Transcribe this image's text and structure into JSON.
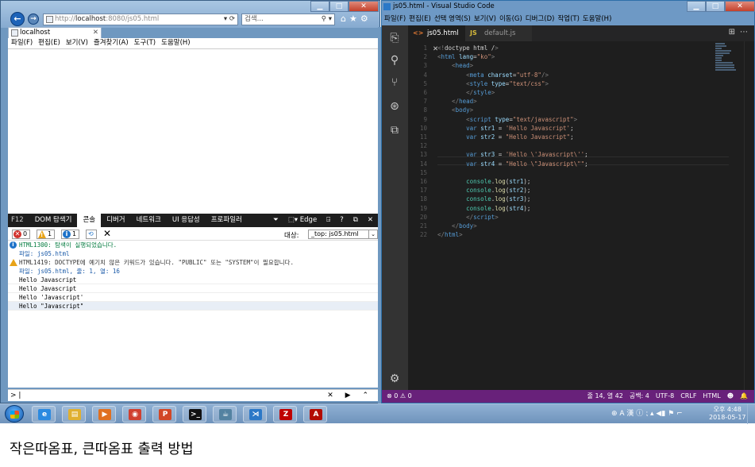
{
  "ie": {
    "address": {
      "prefix": "http://",
      "host": "localhost",
      "rest": ":8080/js05.html",
      "extra": "▾ ⟳"
    },
    "search_placeholder": "검색...",
    "tab_title": "localhost",
    "menu": [
      "파일(F)",
      "편집(E)",
      "보기(V)",
      "즐겨찾기(A)",
      "도구(T)",
      "도움말(H)"
    ],
    "devtools": {
      "f12_label": "F12",
      "tabs": [
        "DOM 탐색기",
        "콘솔",
        "디버거",
        "네트워크",
        "UI 응답성",
        "프로파일러"
      ],
      "right_items": [
        "⏷",
        "⬚▾ Edge",
        "⍈",
        "?",
        "⧉",
        "✕"
      ],
      "counts": {
        "errors": "0",
        "warnings": "1",
        "infos": "1"
      },
      "target_label": "대상:",
      "target_value": "_top: js05.html",
      "messages": [
        {
          "kind": "info",
          "text": "HTML1300: 탐색이 실행되었습니다."
        },
        {
          "kind": "blue",
          "text": "파일: js05.html"
        },
        {
          "kind": "warn",
          "text": "HTML1419: DOCTYPE에 예기치 않은 키워드가 있습니다. \"PUBLIC\" 또는 \"SYSTEM\"이 필요합니다."
        },
        {
          "kind": "blue",
          "text": "파일: js05.html, 줄: 1, 열: 16"
        },
        {
          "kind": "plain",
          "text": "Hello Javascript"
        },
        {
          "kind": "plain",
          "text": "Hello Javascript"
        },
        {
          "kind": "plain",
          "text": "Hello 'Javascript'"
        },
        {
          "kind": "plain",
          "text": "Hello \"Javascript\""
        }
      ],
      "input_prompt": "> |",
      "input_controls": "✕ ▶ ⌃"
    }
  },
  "vscode": {
    "title": "js05.html - Visual Studio Code",
    "window_controls": [
      "▁",
      "□",
      "✕"
    ],
    "menu": [
      "파일(F)",
      "편집(E)",
      "선택 영역(S)",
      "보기(V)",
      "이동(G)",
      "디버그(D)",
      "작업(T)",
      "도움말(H)"
    ],
    "tabs": [
      {
        "icon": "<>",
        "name": "js05.html",
        "close": "✕",
        "active": true
      },
      {
        "icon": "JS",
        "name": "default.js",
        "active": false
      }
    ],
    "code_lines": [
      [
        [
          "<!",
          "#808080"
        ],
        [
          "doctype html /",
          "#d4d4d4"
        ],
        [
          ">",
          "#808080"
        ]
      ],
      [
        [
          "<",
          "#808080"
        ],
        [
          "html ",
          "#569cd6"
        ],
        [
          "lang",
          "#9cdcfe"
        ],
        [
          "=",
          "#d4d4d4"
        ],
        [
          "\"ko\"",
          "#ce9178"
        ],
        [
          ">",
          "#808080"
        ]
      ],
      [
        [
          "    <",
          "#808080"
        ],
        [
          "head",
          "#569cd6"
        ],
        [
          ">",
          "#808080"
        ]
      ],
      [
        [
          "        <",
          "#808080"
        ],
        [
          "meta ",
          "#569cd6"
        ],
        [
          "charset",
          "#9cdcfe"
        ],
        [
          "=",
          "#d4d4d4"
        ],
        [
          "\"utf-8\"",
          "#ce9178"
        ],
        [
          "/>",
          "#808080"
        ]
      ],
      [
        [
          "        <",
          "#808080"
        ],
        [
          "style ",
          "#569cd6"
        ],
        [
          "type",
          "#9cdcfe"
        ],
        [
          "=",
          "#d4d4d4"
        ],
        [
          "\"text/css\"",
          "#ce9178"
        ],
        [
          ">",
          "#808080"
        ]
      ],
      [
        [
          "        </",
          "#808080"
        ],
        [
          "style",
          "#569cd6"
        ],
        [
          ">",
          "#808080"
        ]
      ],
      [
        [
          "    </",
          "#808080"
        ],
        [
          "head",
          "#569cd6"
        ],
        [
          ">",
          "#808080"
        ]
      ],
      [
        [
          "    <",
          "#808080"
        ],
        [
          "body",
          "#569cd6"
        ],
        [
          ">",
          "#808080"
        ]
      ],
      [
        [
          "        <",
          "#808080"
        ],
        [
          "script ",
          "#569cd6"
        ],
        [
          "type",
          "#9cdcfe"
        ],
        [
          "=",
          "#d4d4d4"
        ],
        [
          "\"text/javascript\"",
          "#ce9178"
        ],
        [
          ">",
          "#808080"
        ]
      ],
      [
        [
          "        ",
          "#d4d4d4"
        ],
        [
          "var ",
          "#569cd6"
        ],
        [
          "str1",
          "#9cdcfe"
        ],
        [
          " = ",
          "#d4d4d4"
        ],
        [
          "'Hello Javascript'",
          "#ce9178"
        ],
        [
          ";",
          "#d4d4d4"
        ]
      ],
      [
        [
          "        ",
          "#d4d4d4"
        ],
        [
          "var ",
          "#569cd6"
        ],
        [
          "str2",
          "#9cdcfe"
        ],
        [
          " = ",
          "#d4d4d4"
        ],
        [
          "\"Hello Javascript\"",
          "#ce9178"
        ],
        [
          ";",
          "#d4d4d4"
        ]
      ],
      [
        [
          "",
          "#d4d4d4"
        ]
      ],
      [
        [
          "        ",
          "#d4d4d4"
        ],
        [
          "var ",
          "#569cd6"
        ],
        [
          "str3",
          "#9cdcfe"
        ],
        [
          " = ",
          "#d4d4d4"
        ],
        [
          "'Hello \\'Javascript\\''",
          "#ce9178"
        ],
        [
          ";",
          "#d4d4d4"
        ]
      ],
      [
        [
          "        ",
          "#d4d4d4"
        ],
        [
          "var ",
          "#569cd6"
        ],
        [
          "str4",
          "#9cdcfe"
        ],
        [
          " = ",
          "#d4d4d4"
        ],
        [
          "\"Hello \\\"Javascript\\\"\"",
          "#ce9178"
        ],
        [
          ";",
          "#d4d4d4"
        ]
      ],
      [
        [
          "",
          "#d4d4d4"
        ]
      ],
      [
        [
          "        ",
          "#d4d4d4"
        ],
        [
          "console",
          "#4ec9b0"
        ],
        [
          ".",
          "#d4d4d4"
        ],
        [
          "log",
          "#dcdcaa"
        ],
        [
          "(",
          "#d4d4d4"
        ],
        [
          "str1",
          "#9cdcfe"
        ],
        [
          ");",
          "#d4d4d4"
        ]
      ],
      [
        [
          "        ",
          "#d4d4d4"
        ],
        [
          "console",
          "#4ec9b0"
        ],
        [
          ".",
          "#d4d4d4"
        ],
        [
          "log",
          "#dcdcaa"
        ],
        [
          "(",
          "#d4d4d4"
        ],
        [
          "str2",
          "#9cdcfe"
        ],
        [
          ");",
          "#d4d4d4"
        ]
      ],
      [
        [
          "        ",
          "#d4d4d4"
        ],
        [
          "console",
          "#4ec9b0"
        ],
        [
          ".",
          "#d4d4d4"
        ],
        [
          "log",
          "#dcdcaa"
        ],
        [
          "(",
          "#d4d4d4"
        ],
        [
          "str3",
          "#9cdcfe"
        ],
        [
          ");",
          "#d4d4d4"
        ]
      ],
      [
        [
          "        ",
          "#d4d4d4"
        ],
        [
          "console",
          "#4ec9b0"
        ],
        [
          ".",
          "#d4d4d4"
        ],
        [
          "log",
          "#dcdcaa"
        ],
        [
          "(",
          "#d4d4d4"
        ],
        [
          "str4",
          "#9cdcfe"
        ],
        [
          ");",
          "#d4d4d4"
        ]
      ],
      [
        [
          "        </",
          "#808080"
        ],
        [
          "script",
          "#569cd6"
        ],
        [
          ">",
          "#808080"
        ]
      ],
      [
        [
          "    </",
          "#808080"
        ],
        [
          "body",
          "#569cd6"
        ],
        [
          ">",
          "#808080"
        ]
      ],
      [
        [
          "</",
          "#808080"
        ],
        [
          "html",
          "#569cd6"
        ],
        [
          ">",
          "#808080"
        ]
      ]
    ],
    "status": {
      "left": "⊗ 0 ⚠ 0",
      "right": [
        "줄 14, 열 42",
        "공백: 4",
        "UTF-8",
        "CRLF",
        "HTML",
        "☻",
        "🔔"
      ]
    },
    "status_color": "#68217a"
  },
  "taskbar": {
    "apps": [
      {
        "name": "ie",
        "glyph": "e",
        "color": "#2b8ae0"
      },
      {
        "name": "explorer",
        "glyph": "▤",
        "color": "#e0b030"
      },
      {
        "name": "media-player",
        "glyph": "▶",
        "color": "#e07020"
      },
      {
        "name": "chrome",
        "glyph": "◉",
        "color": "#d04030"
      },
      {
        "name": "powerpoint",
        "glyph": "P",
        "color": "#d24726"
      },
      {
        "name": "cmd",
        "glyph": ">_",
        "color": "#111111"
      },
      {
        "name": "java",
        "glyph": "☕",
        "color": "#5382a1"
      },
      {
        "name": "vscode",
        "glyph": "⋊",
        "color": "#2b78c7"
      },
      {
        "name": "filezilla",
        "glyph": "Z",
        "color": "#bf0000"
      },
      {
        "name": "acrobat",
        "glyph": "A",
        "color": "#b30b00"
      }
    ],
    "tray": "⊕ A 漢 ⓘ ⁏ ▴ ◀▮ ⚑ ⌐",
    "time": "오후 4:48",
    "date": "2018-05-17"
  },
  "caption": "작은따옴표, 큰따옴표 출력 방법"
}
